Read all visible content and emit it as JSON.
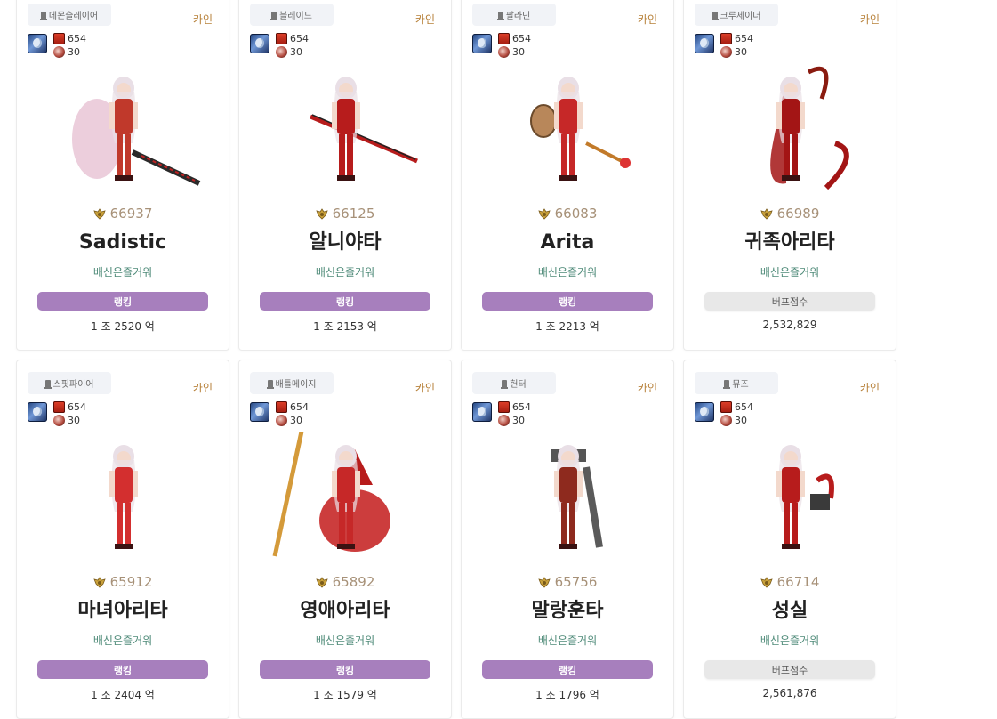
{
  "cards": [
    {
      "job": "데몬슬레이어",
      "server": "카인",
      "set_level": "654",
      "title_level": "30",
      "fame": "66937",
      "name": "Sadistic",
      "guild": "배신은즐거워",
      "button": "랭킹",
      "button_style": "purple",
      "value": "1 조 2520 억",
      "portrait": "sadistic-portrait",
      "accent": "#c0392b"
    },
    {
      "job": "블레이드",
      "server": "카인",
      "set_level": "654",
      "title_level": "30",
      "fame": "66125",
      "name": "알니야타",
      "guild": "배신은즐거워",
      "button": "랭킹",
      "button_style": "purple",
      "value": "1 조 2153 억",
      "portrait": "blade-portrait",
      "accent": "#b71c1c"
    },
    {
      "job": "팔라딘",
      "server": "카인",
      "set_level": "654",
      "title_level": "30",
      "fame": "66083",
      "name": "Arita",
      "guild": "배신은즐거워",
      "button": "랭킹",
      "button_style": "purple",
      "value": "1 조 2213 억",
      "portrait": "paladin-portrait",
      "accent": "#c62828"
    },
    {
      "job": "크루세이더",
      "server": "카인",
      "set_level": "654",
      "title_level": "30",
      "fame": "66989",
      "name": "귀족아리타",
      "guild": "배신은즐거워",
      "button": "버프점수",
      "button_style": "gray",
      "value": "2,532,829",
      "portrait": "crusader-portrait",
      "accent": "#a31515"
    },
    {
      "job": "스핏파이어",
      "server": "카인",
      "set_level": "654",
      "title_level": "30",
      "fame": "65912",
      "name": "마녀아리타",
      "guild": "배신은즐거워",
      "button": "랭킹",
      "button_style": "purple",
      "value": "1 조 2404 억",
      "portrait": "spitfire-portrait",
      "accent": "#d32f2f"
    },
    {
      "job": "배틀메이지",
      "server": "카인",
      "set_level": "654",
      "title_level": "30",
      "fame": "65892",
      "name": "영애아리타",
      "guild": "배신은즐거워",
      "button": "랭킹",
      "button_style": "purple",
      "value": "1 조 1579 억",
      "portrait": "battlemage-portrait",
      "accent": "#c62828"
    },
    {
      "job": "헌터",
      "server": "카인",
      "set_level": "654",
      "title_level": "30",
      "fame": "65756",
      "name": "말랑훈타",
      "guild": "배신은즐거워",
      "button": "랭킹",
      "button_style": "purple",
      "value": "1 조 1796 억",
      "portrait": "hunter-portrait",
      "accent": "#8e2a1e"
    },
    {
      "job": "뮤즈",
      "server": "카인",
      "set_level": "654",
      "title_level": "30",
      "fame": "66714",
      "name": "성실",
      "guild": "배신은즐거워",
      "button": "버프점수",
      "button_style": "gray",
      "value": "2,561,876",
      "portrait": "muse-portrait",
      "accent": "#b71c1c"
    }
  ]
}
